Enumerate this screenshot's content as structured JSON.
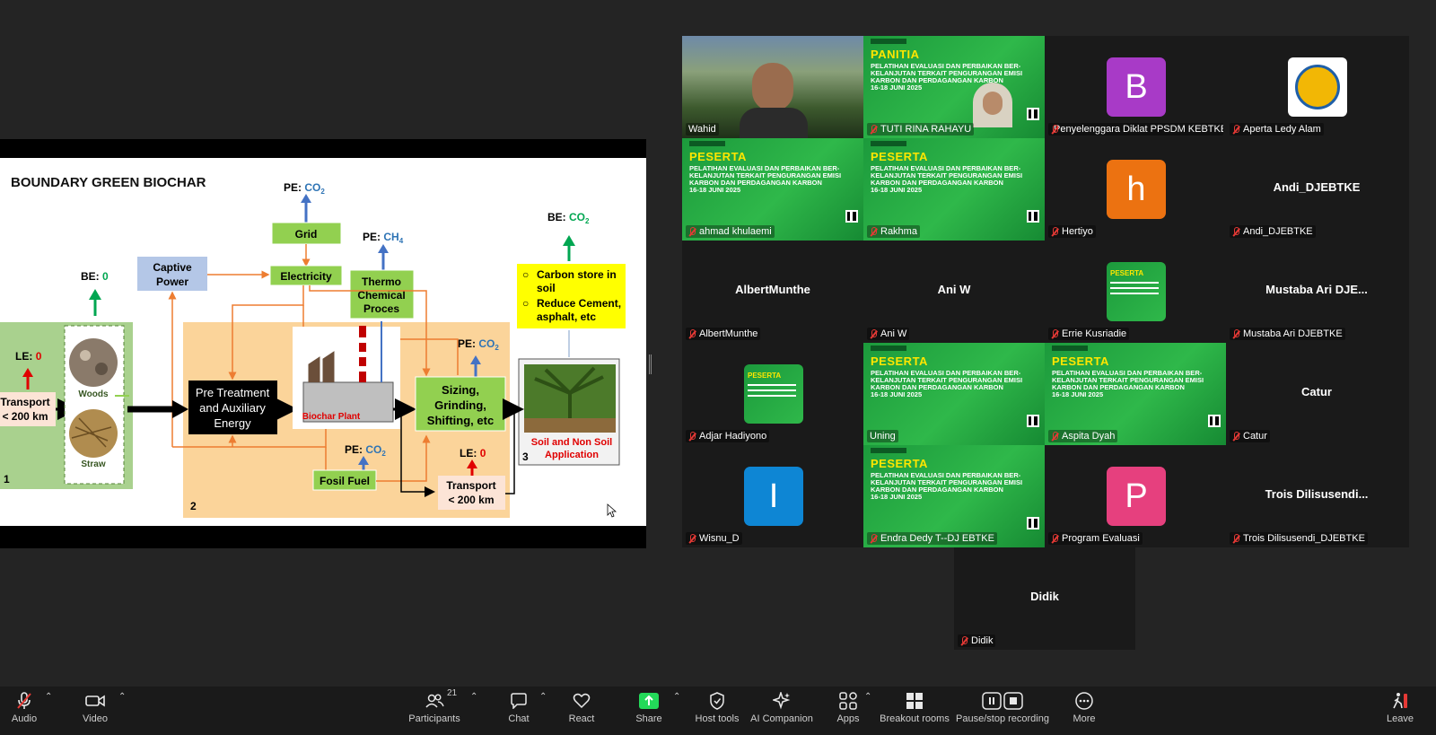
{
  "slide": {
    "title": "BOUNDARY GREEN BIOCHAR",
    "labels": {
      "pe": "PE:",
      "be": "BE:",
      "le": "LE:",
      "co2": "CO",
      "ch4": "CH",
      "sub2": "2",
      "sub4": "4",
      "zero": "0",
      "grid": "Grid",
      "electricity": "Electricity",
      "captive1": "Captive",
      "captive2": "Power",
      "thermo1": "Thermo",
      "thermo2": "Chemical",
      "thermo3": "Proces",
      "carbon1": "Carbon store in",
      "carbon2": "soil",
      "carbon3": "Reduce Cement,",
      "carbon4": "asphalt, etc",
      "transport1": "Transport",
      "transport2": "< 200 km",
      "woods": "Woods",
      "straw": "Straw",
      "pretreat1": "Pre Treatment",
      "pretreat2": "and Auxiliary",
      "pretreat3": "Energy",
      "biochar_plant": "Biochar Plant",
      "sizing1": "Sizing,",
      "sizing2": "Grinding,",
      "sizing3": "Shifting, etc",
      "fosil": "Fosil Fuel",
      "soil1": "Soil and Non Soil",
      "soil2": "Application",
      "n1": "1",
      "n2": "2",
      "n3": "3"
    }
  },
  "gallery": {
    "tiles": [
      {
        "name": "Wahid",
        "muted": false,
        "type": "video"
      },
      {
        "name": "TUTI RINA RAHAYU",
        "muted": true,
        "type": "banner",
        "role": "PANITIA"
      },
      {
        "name": "Penyelenggara Diklat PPSDM KEBTKE",
        "muted": true,
        "type": "avatar",
        "letter": "B",
        "color": "#a83ac7"
      },
      {
        "name": "Aperta Ledy Alam",
        "muted": true,
        "type": "photo"
      },
      {
        "name": "ahmad khulaemi",
        "muted": true,
        "type": "banner",
        "role": "PESERTA"
      },
      {
        "name": "Rakhma",
        "muted": true,
        "type": "banner",
        "role": "PESERTA"
      },
      {
        "name": "Hertiyo",
        "muted": true,
        "type": "avatar",
        "letter": "h",
        "color": "#ec7211"
      },
      {
        "name": "Andi_DJEBTKE",
        "muted": true,
        "type": "name",
        "big": "Andi_DJEBTKE"
      },
      {
        "name": "AlbertMunthe",
        "muted": true,
        "type": "name",
        "big": "AlbertMunthe"
      },
      {
        "name": "Ani W",
        "muted": true,
        "type": "name",
        "big": "Ani W"
      },
      {
        "name": "Errie Kusriadie",
        "muted": true,
        "type": "thumb"
      },
      {
        "name": "Mustaba Ari DJEBTKE",
        "muted": true,
        "type": "name",
        "big": "Mustaba Ari DJE..."
      },
      {
        "name": "Adjar Hadiyono",
        "muted": true,
        "type": "thumb"
      },
      {
        "name": "Uning",
        "muted": false,
        "type": "banner",
        "role": "PESERTA"
      },
      {
        "name": "Aspita Dyah",
        "muted": true,
        "type": "banner",
        "role": "PESERTA"
      },
      {
        "name": "Catur",
        "muted": true,
        "type": "name",
        "big": "Catur"
      },
      {
        "name": "Wisnu_D",
        "muted": true,
        "type": "avatar",
        "letter": "I",
        "color": "#0e86d4"
      },
      {
        "name": "Endra Dedy T--DJ EBTKE",
        "muted": true,
        "type": "banner",
        "role": "PESERTA"
      },
      {
        "name": "Program Evaluasi",
        "muted": true,
        "type": "avatar",
        "letter": "P",
        "color": "#e6407e"
      },
      {
        "name": "Trois Dilisusendi_DJEBTKE",
        "muted": true,
        "type": "name",
        "big": "Trois  Dilisusendi..."
      },
      {
        "name": "Didik",
        "muted": true,
        "type": "name",
        "big": "Didik"
      }
    ],
    "banner_lines": [
      "PELATIHAN EVALUASI DAN PERBAIKAN BER-",
      "KELANJUTAN TERKAIT PENGURANGAN EMISI",
      "KARBON DAN PERDAGANGAN KARBON",
      "16-18 JUNI 2025"
    ]
  },
  "toolbar": {
    "audio": "Audio",
    "video": "Video",
    "participants": "Participants",
    "participants_count": "21",
    "chat": "Chat",
    "react": "React",
    "share": "Share",
    "host_tools": "Host tools",
    "ai_companion": "AI Companion",
    "apps": "Apps",
    "breakout": "Breakout rooms",
    "pause": "Pause/stop recording",
    "more": "More",
    "leave": "Leave"
  },
  "colors": {
    "share_green": "#23d959",
    "leave_red": "#e53935"
  }
}
